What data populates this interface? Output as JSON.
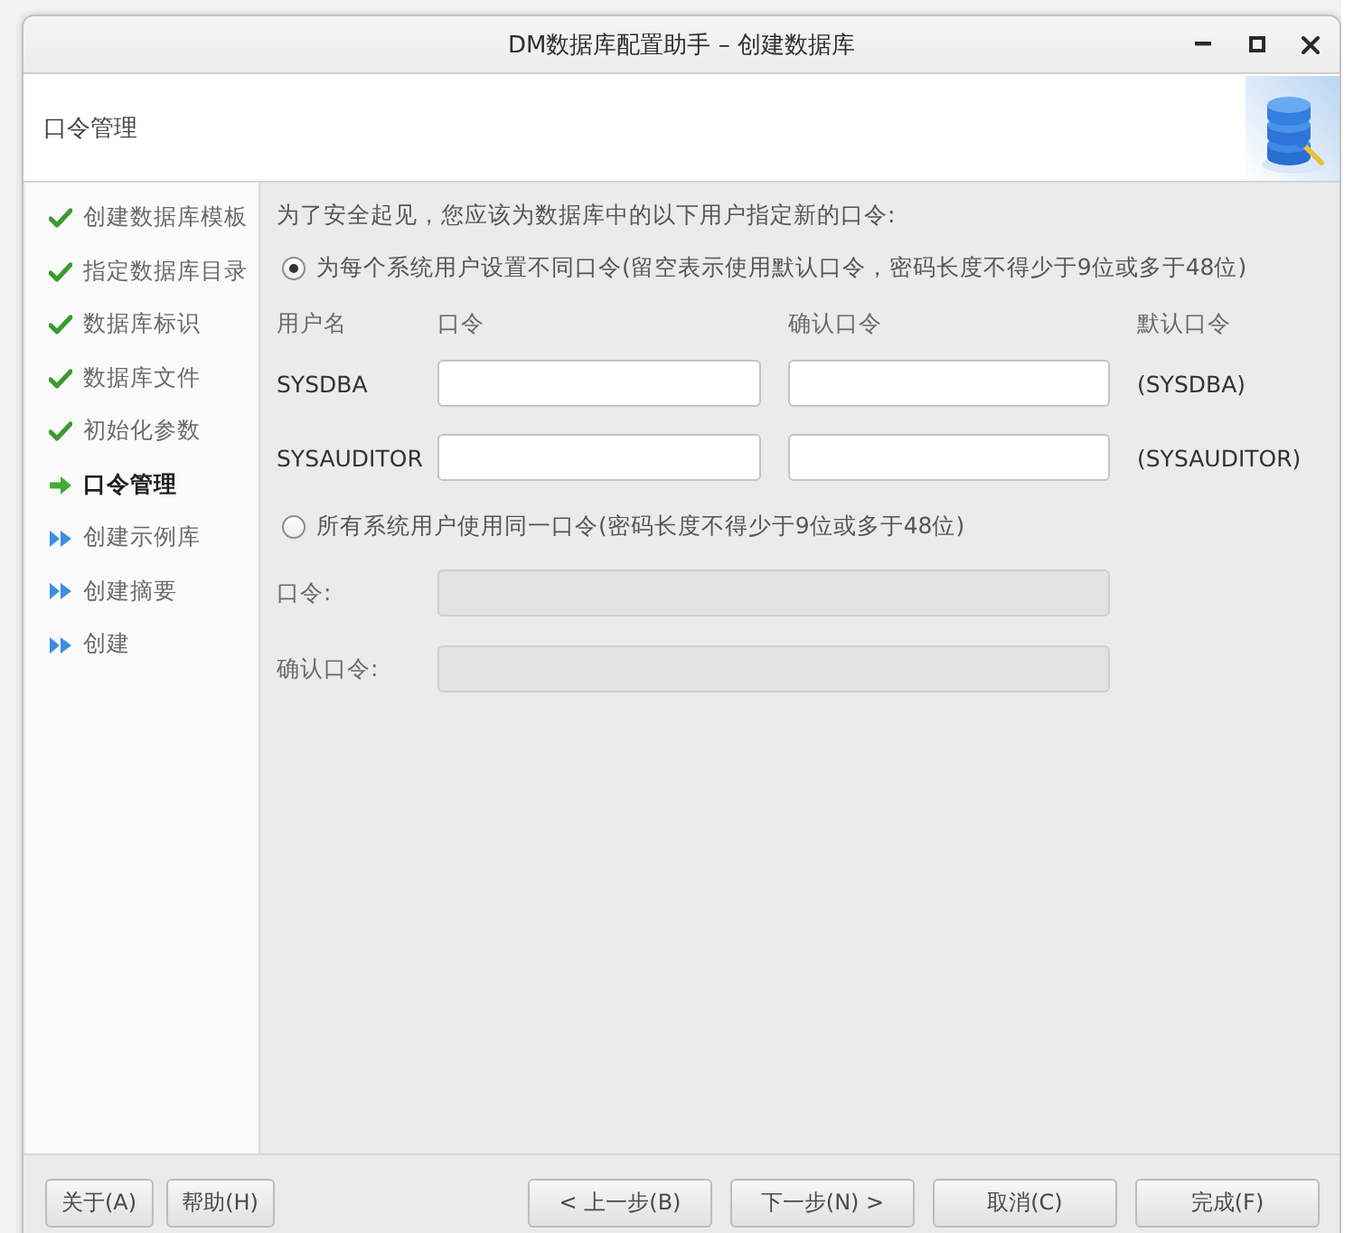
{
  "window": {
    "title": "DM数据库配置助手 – 创建数据库"
  },
  "header": {
    "title": "口令管理"
  },
  "steps": [
    {
      "label": "创建数据库模板",
      "kind": "done"
    },
    {
      "label": "指定数据库目录",
      "kind": "done"
    },
    {
      "label": "数据库标识",
      "kind": "done"
    },
    {
      "label": "数据库文件",
      "kind": "done"
    },
    {
      "label": "初始化参数",
      "kind": "done"
    },
    {
      "label": "口令管理",
      "kind": "current"
    },
    {
      "label": "创建示例库",
      "kind": "pending"
    },
    {
      "label": "创建摘要",
      "kind": "pending"
    },
    {
      "label": "创建",
      "kind": "pending"
    }
  ],
  "intro": "为了安全起见，您应该为数据库中的以下用户指定新的口令:",
  "per_user_option": {
    "label": "为每个系统用户设置不同口令(留空表示使用默认口令，密码长度不得少于9位或多于48位)",
    "selected": true,
    "columns": [
      "用户名",
      "口令",
      "确认口令",
      "默认口令"
    ],
    "users": [
      {
        "name": "SYSDBA",
        "default_password": "(SYSDBA)"
      },
      {
        "name": "SYSAUDITOR",
        "default_password": "(SYSAUDITOR)"
      }
    ]
  },
  "shared_option": {
    "label": "所有系统用户使用同一口令(密码长度不得少于9位或多于48位)",
    "selected": false,
    "fields": [
      {
        "label": "口令:"
      },
      {
        "label": "确认口令:"
      }
    ]
  },
  "buttons_left": [
    {
      "label": "关于(A)"
    },
    {
      "label": "帮助(H)"
    }
  ],
  "buttons_right": [
    {
      "label": "< 上一步(B)"
    },
    {
      "label": "下一步(N) >"
    },
    {
      "label": "取消(C)"
    },
    {
      "label": "完成(F)"
    }
  ]
}
